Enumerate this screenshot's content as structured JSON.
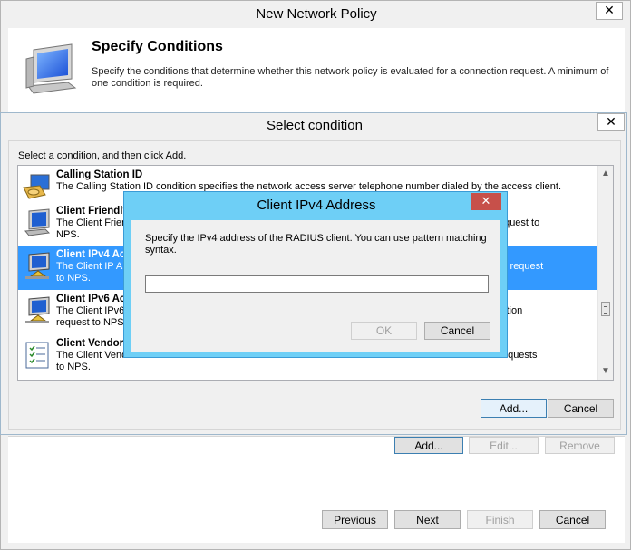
{
  "policy_window": {
    "title": "New Network Policy",
    "heading": "Specify Conditions",
    "description": "Specify the conditions that determine whether this network policy is evaluated for a connection request. A minimum of one condition is required.",
    "condition_buttons": {
      "add": "Add...",
      "edit": "Edit...",
      "remove": "Remove"
    },
    "nav_buttons": {
      "previous": "Previous",
      "next": "Next",
      "finish": "Finish",
      "cancel": "Cancel"
    }
  },
  "select_condition": {
    "title": "Select condition",
    "instruction": "Select a condition, and then click Add.",
    "conditions": [
      {
        "name": "Calling Station ID",
        "description": "The Calling Station ID condition specifies the network access server telephone number dialed by the access client."
      },
      {
        "name": "Client Friendly",
        "description_left": "The Client Frien",
        "description_right": "ction request to",
        "description_line2": "NPS."
      },
      {
        "name": "Client IPv4 Ac",
        "description_left": "The Client IP A",
        "description_right": "nection request",
        "description_line2": "to NPS."
      },
      {
        "name": "Client IPv6 Ac",
        "description_left": "The Client IPv6",
        "description_right": "connection",
        "description_line2": "request to NPS."
      },
      {
        "name": "Client Vendor",
        "description_left": "The Client Vend",
        "description_right": "ction requests",
        "description_line2": "to NPS."
      }
    ],
    "selected_index": 2,
    "buttons": {
      "add": "Add...",
      "cancel": "Cancel"
    }
  },
  "ipv4_dialog": {
    "title": "Client IPv4 Address",
    "prompt": "Specify the IPv4 address of the RADIUS client. You can use pattern matching syntax.",
    "input_value": "",
    "buttons": {
      "ok": "OK",
      "cancel": "Cancel"
    }
  },
  "icons": {
    "close": "✕",
    "dialog_close": "✕",
    "scroll_up": "▲",
    "scroll_down": "▼"
  },
  "colors": {
    "selection": "#3399ff",
    "dialog_frame": "#6ecff6",
    "dialog_close": "#c7504a"
  }
}
